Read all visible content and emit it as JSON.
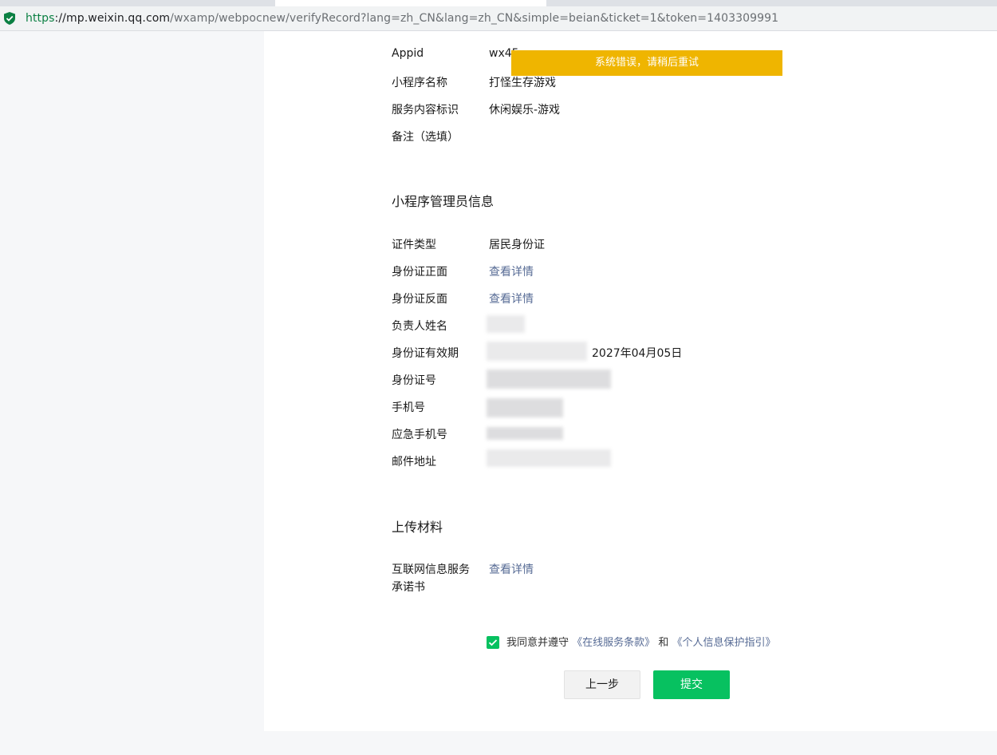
{
  "browser": {
    "url_scheme": "https",
    "url_host": "://mp.weixin.qq.com",
    "url_path": "/wxamp/webpocnew/verifyRecord?lang=zh_CN&lang=zh_CN&simple=beian&ticket=1&token=1403309991"
  },
  "toast": {
    "message": "系统错误，请稍后重试"
  },
  "basic_info": {
    "appid_label": "Appid",
    "appid_value": "wx45",
    "name_label": "小程序名称",
    "name_value": "打怪生存游戏",
    "service_label": "服务内容标识",
    "service_value": "休闲娱乐-游戏",
    "remark_label": "备注（选填）"
  },
  "admin_info": {
    "title": "小程序管理员信息",
    "id_type_label": "证件类型",
    "id_type_value": "居民身份证",
    "id_front_label": "身份证正面",
    "id_front_link": "查看详情",
    "id_back_label": "身份证反面",
    "id_back_link": "查看详情",
    "owner_name_label": "负责人姓名",
    "id_validity_label": "身份证有效期",
    "id_validity_value": "2027年04月05日",
    "id_number_label": "身份证号",
    "phone_label": "手机号",
    "emergency_phone_label": "应急手机号",
    "email_label": "邮件地址"
  },
  "materials": {
    "title": "上传材料",
    "commitment_label_line1": "互联网信息服务",
    "commitment_label_line2": "承诺书",
    "commitment_link": "查看详情"
  },
  "agreement": {
    "checked": true,
    "prefix": "我同意并遵守",
    "terms_link": "《在线服务条款》",
    "conjunction": "和",
    "privacy_link": "《个人信息保护指引》"
  },
  "buttons": {
    "prev_label": "上一步",
    "submit_label": "提交"
  },
  "colors": {
    "accent_green": "#07c160",
    "toast_yellow": "#efb500",
    "link_blue": "#576b95"
  }
}
